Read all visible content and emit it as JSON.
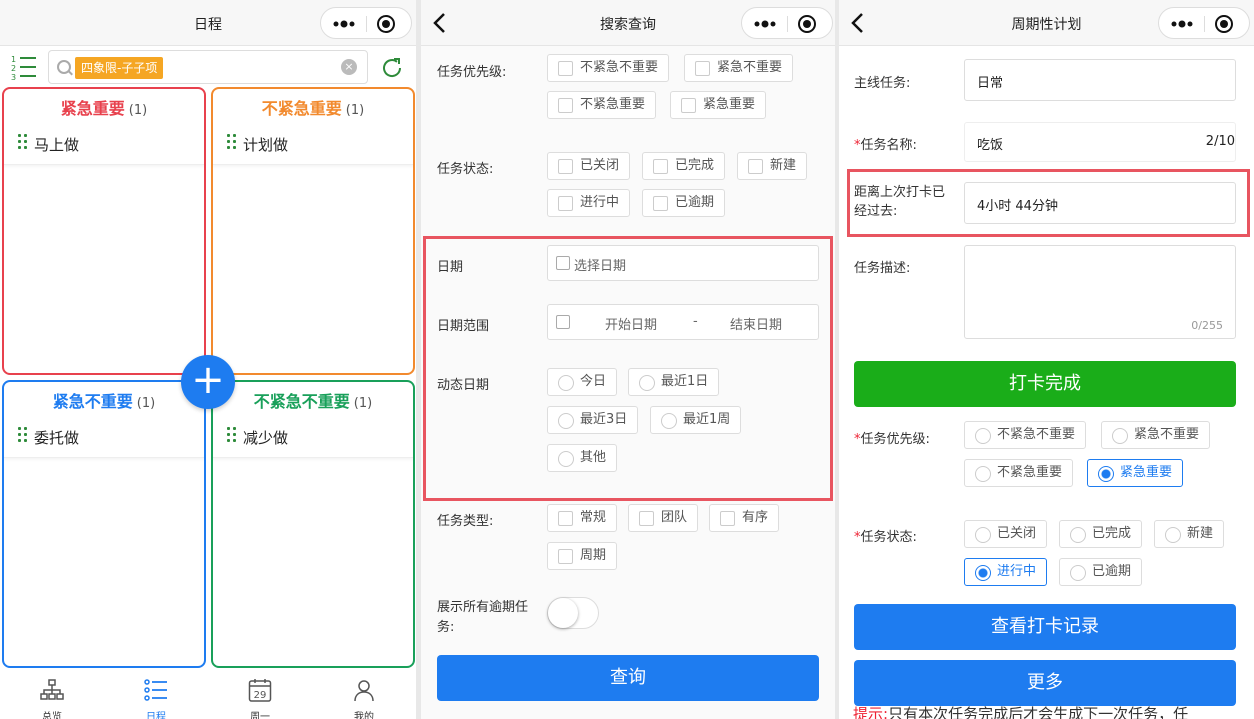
{
  "panel1": {
    "nav": {
      "title": "日程"
    },
    "search": {
      "tag": "四象限-子子项"
    },
    "quadrants": [
      {
        "title": "紧急重要",
        "count": "(1)",
        "item": "马上做",
        "color": "#e8414d"
      },
      {
        "title": "不紧急重要",
        "count": "(1)",
        "item": "计划做",
        "color": "#f28a2e"
      },
      {
        "title": "紧急不重要",
        "count": "(1)",
        "item": "委托做",
        "color": "#1e7cf0"
      },
      {
        "title": "不紧急不重要",
        "count": "(1)",
        "item": "减少做",
        "color": "#19a05a"
      }
    ],
    "fab_label": "+",
    "tabs": [
      {
        "label": "总览",
        "icon": "org-chart-icon"
      },
      {
        "label": "日程",
        "icon": "list-icon",
        "active": true
      },
      {
        "label": "周一",
        "icon": "calendar-icon",
        "day": "29"
      },
      {
        "label": "我的",
        "icon": "person-icon"
      }
    ]
  },
  "panel2": {
    "nav": {
      "title": "搜索查询"
    },
    "priority": {
      "label": "任务优先级:",
      "options": [
        "不紧急不重要",
        "紧急不重要",
        "不紧急重要",
        "紧急重要"
      ]
    },
    "status": {
      "label": "任务状态:",
      "options": [
        "已关闭",
        "已完成",
        "新建",
        "进行中",
        "已逾期"
      ]
    },
    "date": {
      "label": "日期",
      "placeholder": "选择日期"
    },
    "date_range": {
      "label": "日期范围",
      "start": "开始日期",
      "sep": "-",
      "end": "结束日期"
    },
    "dynamic_date": {
      "label": "动态日期",
      "options": [
        "今日",
        "最近1日",
        "最近3日",
        "最近1周",
        "其他"
      ]
    },
    "type": {
      "label": "任务类型:",
      "options": [
        "常规",
        "团队",
        "有序",
        "周期"
      ]
    },
    "overdue": {
      "label_line1": "展示所有逾期任",
      "label_line2": "务:"
    },
    "query_button": "查询"
  },
  "panel3": {
    "nav": {
      "title": "周期性计划"
    },
    "main_task": {
      "label": "主线任务:",
      "value": "日常"
    },
    "task_name": {
      "star": "*",
      "label": "任务名称:",
      "value": "吃饭",
      "counter": "2/10"
    },
    "elapsed": {
      "label_line1": "距离上次打卡已",
      "label_line2": "经过去:",
      "value": "4小时 44分钟"
    },
    "description": {
      "label": "任务描述:",
      "counter": "0/255"
    },
    "checkin_button": "打卡完成",
    "priority": {
      "star": "*",
      "label": "任务优先级:",
      "options": [
        "不紧急不重要",
        "紧急不重要",
        "不紧急重要",
        "紧急重要"
      ],
      "selected": "紧急重要"
    },
    "status": {
      "star": "*",
      "label": "任务状态:",
      "options": [
        "已关闭",
        "已完成",
        "新建",
        "进行中",
        "已逾期"
      ],
      "selected": "进行中"
    },
    "records_button": "查看打卡记录",
    "more_button": "更多",
    "hint": {
      "prefix": "提示:",
      "text": "只有本次任务完成后才会生成下一次任务，任"
    }
  },
  "colors": {
    "primary": "#1e7cf0",
    "success": "#1aad19",
    "highlight": "#e85560"
  }
}
